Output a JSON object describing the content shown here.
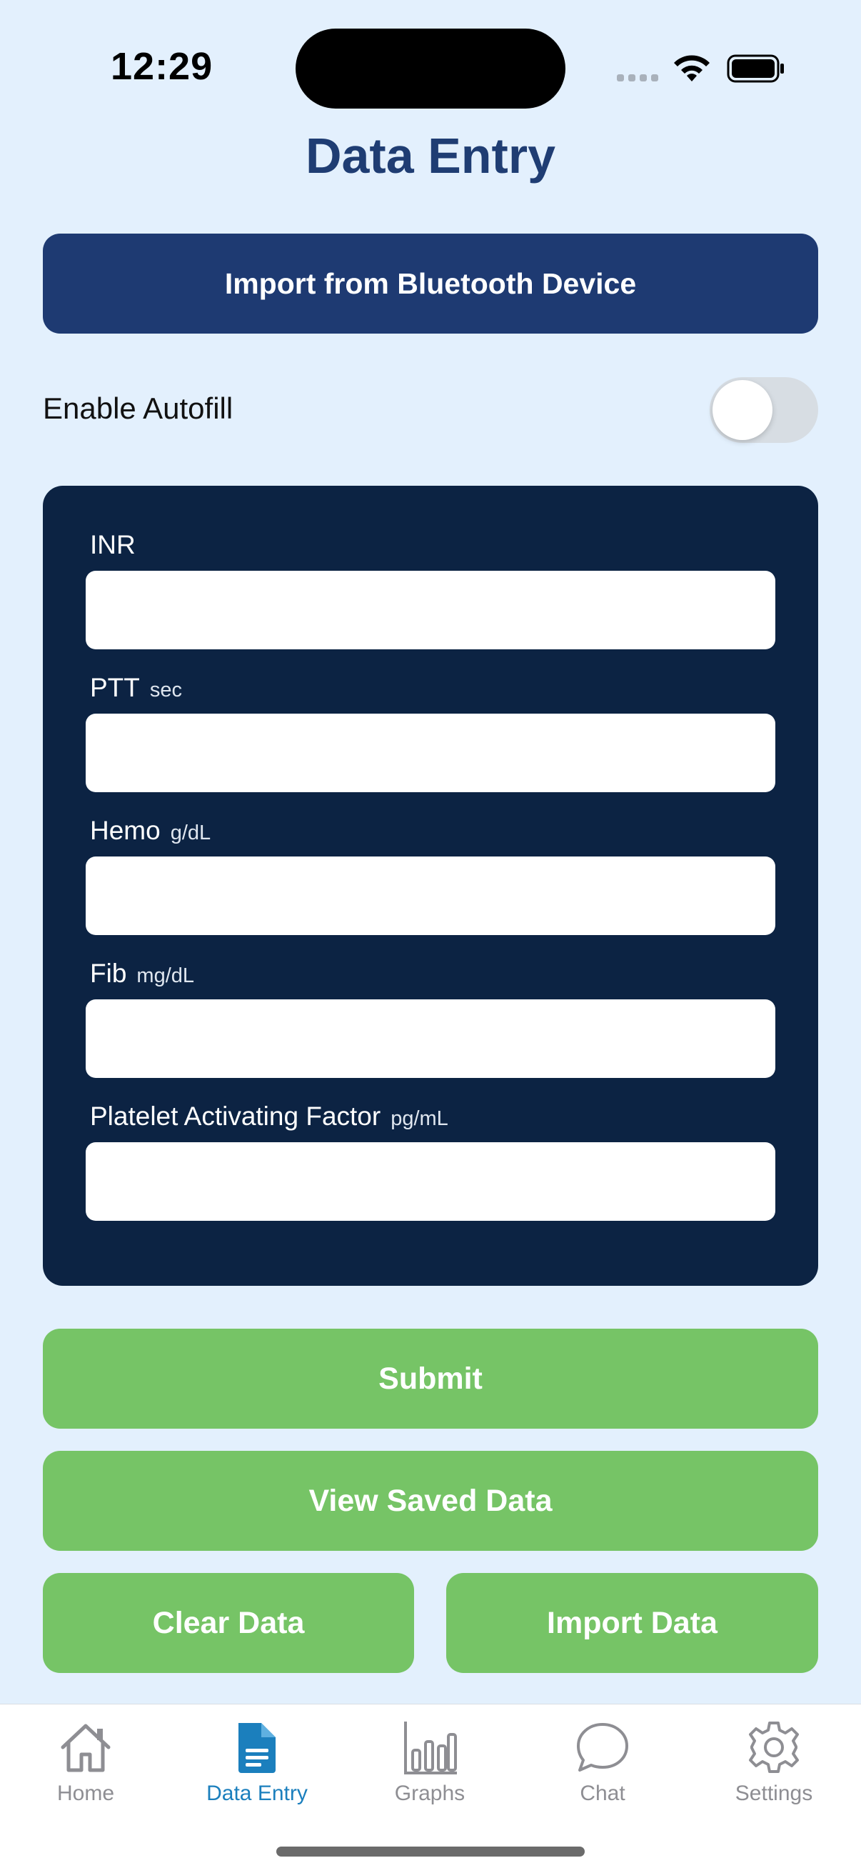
{
  "status": {
    "time": "12:29"
  },
  "header": {
    "title": "Data Entry"
  },
  "actions": {
    "bluetooth_label": "Import from Bluetooth Device"
  },
  "autofill": {
    "label": "Enable Autofill",
    "enabled": false
  },
  "form": {
    "fields": [
      {
        "label": "INR",
        "unit": "",
        "value": ""
      },
      {
        "label": "PTT",
        "unit": "sec",
        "value": ""
      },
      {
        "label": "Hemo",
        "unit": "g/dL",
        "value": ""
      },
      {
        "label": "Fib",
        "unit": "mg/dL",
        "value": ""
      },
      {
        "label": "Platelet Activating Factor",
        "unit": "pg/mL",
        "value": ""
      }
    ]
  },
  "buttons": {
    "submit": "Submit",
    "view_saved": "View Saved Data",
    "clear": "Clear Data",
    "import": "Import Data"
  },
  "tabbar": {
    "items": [
      {
        "label": "Home",
        "icon": "house-icon",
        "active": false
      },
      {
        "label": "Data Entry",
        "icon": "document-icon",
        "active": true
      },
      {
        "label": "Graphs",
        "icon": "chart-icon",
        "active": false
      },
      {
        "label": "Chat",
        "icon": "chat-bubble-icon",
        "active": false
      },
      {
        "label": "Settings",
        "icon": "gear-icon",
        "active": false
      }
    ]
  },
  "colors": {
    "background": "#e3f0fd",
    "primary": "#1e3a72",
    "panel": "#0c2343",
    "green": "#76c466",
    "tab_active": "#1b7fbd",
    "tab_inactive": "#8e8e93"
  }
}
